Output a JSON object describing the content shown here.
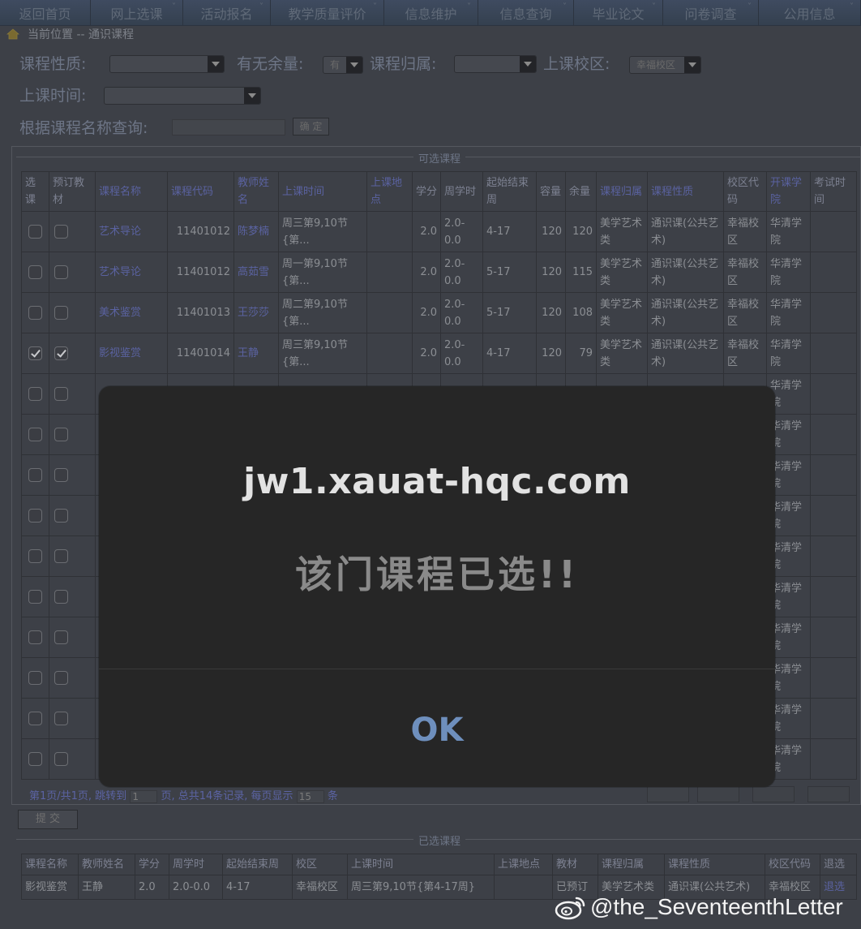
{
  "menu": {
    "items": [
      {
        "label": "返回首页",
        "caret": ""
      },
      {
        "label": "网上选课",
        "caret": "˅"
      },
      {
        "label": "活动报名",
        "caret": "˅"
      },
      {
        "label": "教学质量评价",
        "caret": "˅"
      },
      {
        "label": "信息维护",
        "caret": "˅"
      },
      {
        "label": "信息查询",
        "caret": "˅"
      },
      {
        "label": "毕业论文",
        "caret": "˅"
      },
      {
        "label": "问卷调查",
        "caret": "˅"
      },
      {
        "label": "公用信息",
        "caret": "˅"
      }
    ]
  },
  "breadcrumb": "当前位置 -- 通识课程",
  "filters": {
    "course_type_label": "课程性质:",
    "course_type_value": "",
    "remaining_label": "有无余量:",
    "remaining_value": "有",
    "belong_label": "课程归属:",
    "belong_value": "",
    "campus_label": "上课校区:",
    "campus_value": "幸福校区",
    "time_label": "上课时间:",
    "time_value": "",
    "name_query_label": "根据课程名称查询:",
    "name_query_value": "",
    "confirm_label": "确 定"
  },
  "available": {
    "legend": "可选课程",
    "headers": [
      "选课",
      "预订教材",
      "课程名称",
      "课程代码",
      "教师姓名",
      "上课时间",
      "上课地点",
      "学分",
      "周学时",
      "起始结束周",
      "容量",
      "余量",
      "课程归属",
      "课程性质",
      "校区代码",
      "开课学院",
      "考试时间"
    ],
    "rows": [
      {
        "select": false,
        "book": false,
        "name": "艺术导论",
        "code": "11401012",
        "teacher": "陈梦楠",
        "time": "周三第9,10节{第...",
        "place": "",
        "credit": "2.0",
        "hours": "2.0-0.0",
        "weeks": "4-17",
        "capacity": "120",
        "remain": "120",
        "belong": "美学艺术类",
        "type": "通识课(公共艺术)",
        "campus": "幸福校区",
        "college": "华清学院",
        "exam": ""
      },
      {
        "select": false,
        "book": false,
        "name": "艺术导论",
        "code": "11401012",
        "teacher": "高茹雪",
        "time": "周一第9,10节{第...",
        "place": "",
        "credit": "2.0",
        "hours": "2.0-0.0",
        "weeks": "5-17",
        "capacity": "120",
        "remain": "115",
        "belong": "美学艺术类",
        "type": "通识课(公共艺术)",
        "campus": "幸福校区",
        "college": "华清学院",
        "exam": ""
      },
      {
        "select": false,
        "book": false,
        "name": "美术鉴赏",
        "code": "11401013",
        "teacher": "王莎莎",
        "time": "周二第9,10节{第...",
        "place": "",
        "credit": "2.0",
        "hours": "2.0-0.0",
        "weeks": "5-17",
        "capacity": "120",
        "remain": "108",
        "belong": "美学艺术类",
        "type": "通识课(公共艺术)",
        "campus": "幸福校区",
        "college": "华清学院",
        "exam": ""
      },
      {
        "select": true,
        "book": true,
        "name": "影视鉴赏",
        "code": "11401014",
        "teacher": "王静",
        "time": "周三第9,10节{第...",
        "place": "",
        "credit": "2.0",
        "hours": "2.0-0.0",
        "weeks": "4-17",
        "capacity": "120",
        "remain": "79",
        "belong": "美学艺术类",
        "type": "通识课(公共艺术)",
        "campus": "幸福校区",
        "college": "华清学院",
        "exam": ""
      },
      {
        "select": false,
        "book": false,
        "college": "华清学院"
      },
      {
        "select": false,
        "book": false,
        "college": "华清学院"
      },
      {
        "select": false,
        "book": false,
        "college": "华清学院"
      },
      {
        "select": false,
        "book": false,
        "college": "华清学院"
      },
      {
        "select": false,
        "book": false,
        "college": "华清学院"
      },
      {
        "select": false,
        "book": false,
        "college": "华清学院"
      },
      {
        "select": false,
        "book": false,
        "college": "华清学院"
      },
      {
        "select": false,
        "book": false,
        "college": "华清学院"
      },
      {
        "select": false,
        "book": false,
        "college": "华清学院"
      },
      {
        "select": false,
        "book": false,
        "college": "华清学院"
      }
    ],
    "pager": {
      "prefix": "第1页/共1页, 跳转到",
      "page_value": "1",
      "middle": "页, 总共14条记录, 每页显示",
      "per_page_value": "15",
      "suffix": "条"
    }
  },
  "submit_label": "提 交",
  "selected": {
    "legend": "已选课程",
    "headers": [
      "课程名称",
      "教师姓名",
      "学分",
      "周学时",
      "起始结束周",
      "校区",
      "上课时间",
      "上课地点",
      "教材",
      "课程归属",
      "课程性质",
      "校区代码",
      "退选"
    ],
    "rows": [
      [
        "影视鉴赏",
        "王静",
        "2.0",
        "2.0-0.0",
        "4-17",
        "幸福校区",
        "周三第9,10节{第4-17周}",
        "",
        "已预订",
        "美学艺术类",
        "通识课(公共艺术)",
        "幸福校区",
        "退选"
      ]
    ]
  },
  "dialog": {
    "host": "jw1.xauat-hqc.com",
    "message": "该门课程已选!!",
    "ok_label": "OK"
  },
  "watermark": "@the_SeventeenthLetter"
}
